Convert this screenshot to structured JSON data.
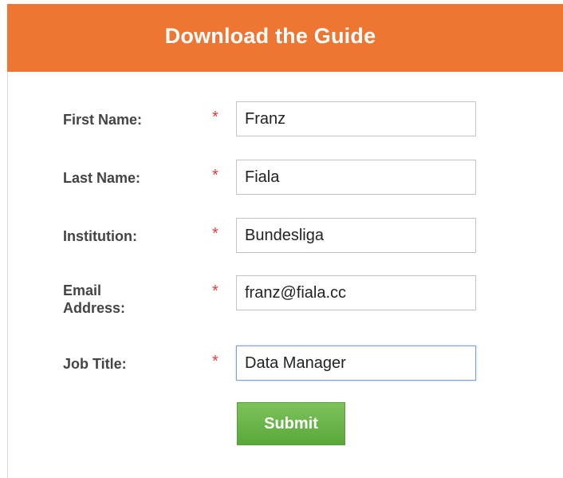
{
  "header": {
    "title": "Download the Guide",
    "color": "#ee7633"
  },
  "form": {
    "fields": [
      {
        "label": "First Name:",
        "value": "Franz",
        "required_mark": "*"
      },
      {
        "label": "Last Name:",
        "value": "Fiala",
        "required_mark": "*"
      },
      {
        "label": "Institution:",
        "value": "Bundesliga",
        "required_mark": "*"
      },
      {
        "label": "Email Address:",
        "value": "franz@fiala.cc",
        "required_mark": "*"
      },
      {
        "label": "Job Title:",
        "value": "Data Manager",
        "required_mark": "*",
        "focused": true
      }
    ],
    "submit_label": "Submit",
    "submit_color": "#6cb84a"
  }
}
